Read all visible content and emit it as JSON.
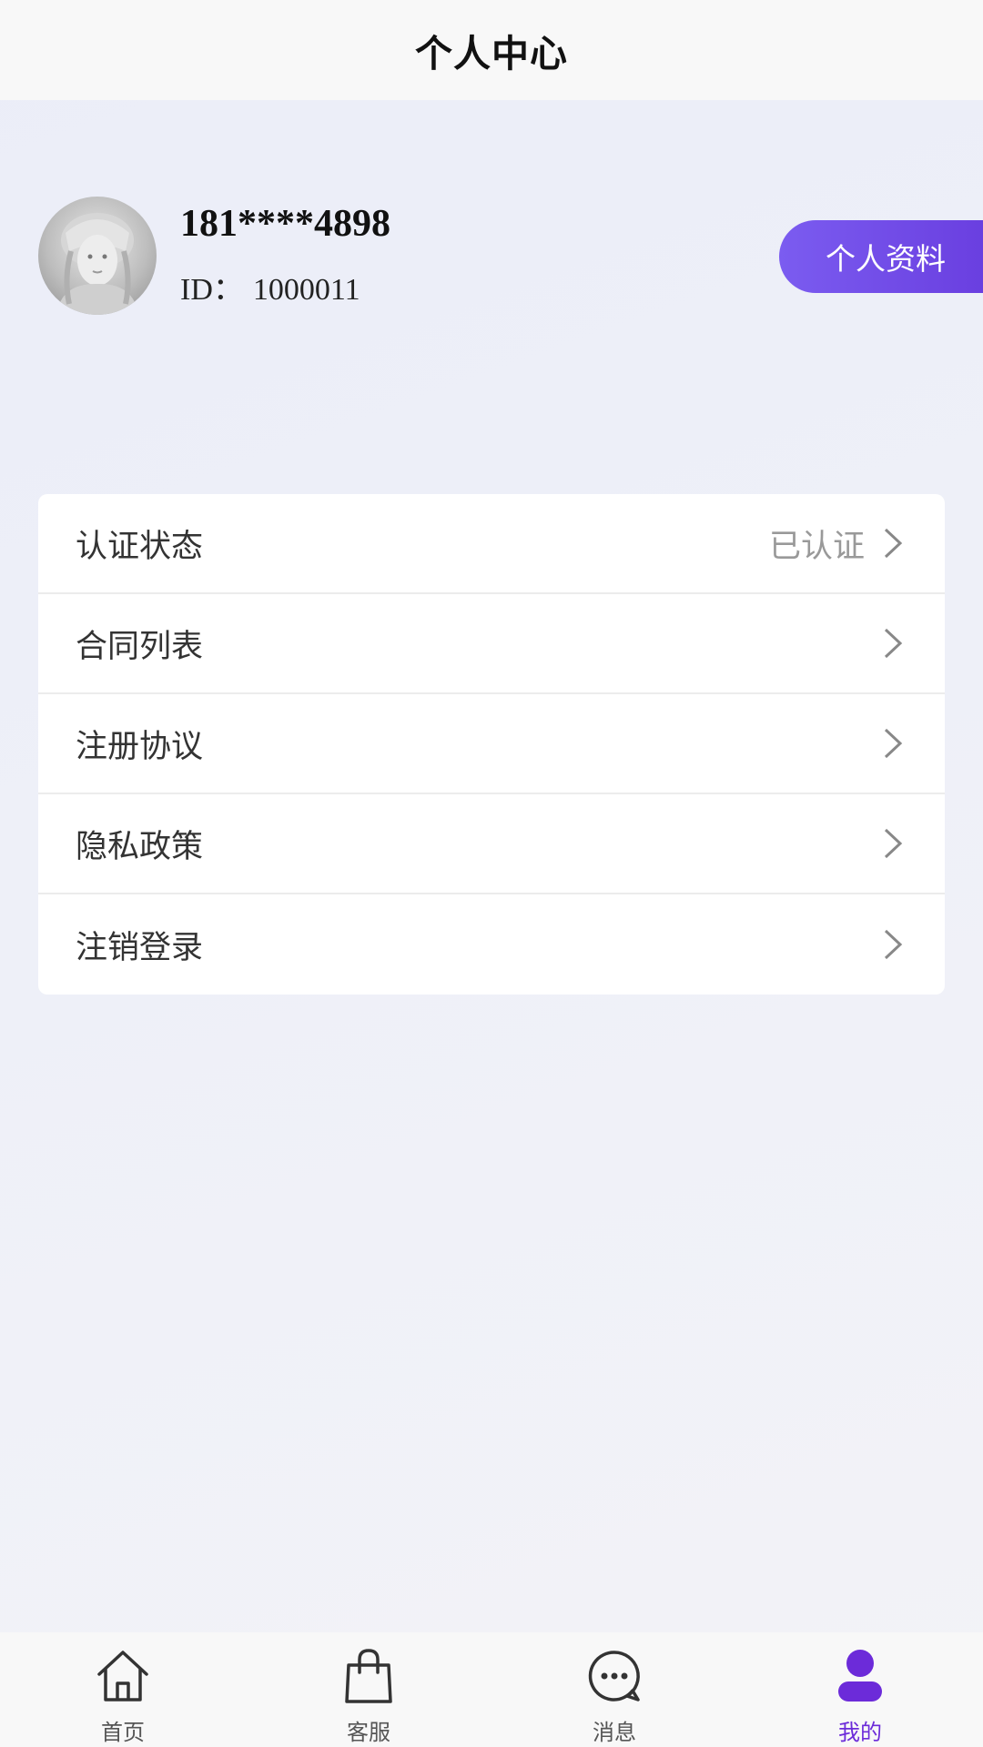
{
  "header": {
    "title": "个人中心"
  },
  "profile": {
    "phone": "181****4898",
    "id_label": "ID：",
    "id_value": "1000011",
    "profile_button": "个人资料"
  },
  "menu": {
    "items": [
      {
        "label": "认证状态",
        "value": "已认证"
      },
      {
        "label": "合同列表",
        "value": ""
      },
      {
        "label": "注册协议",
        "value": ""
      },
      {
        "label": "隐私政策",
        "value": ""
      },
      {
        "label": "注销登录",
        "value": ""
      }
    ]
  },
  "tabbar": {
    "items": [
      {
        "label": "首页",
        "icon": "home-icon",
        "active": false
      },
      {
        "label": "客服",
        "icon": "shopping-bag-icon",
        "active": false
      },
      {
        "label": "消息",
        "icon": "chat-bubble-icon",
        "active": false
      },
      {
        "label": "我的",
        "icon": "user-icon",
        "active": true
      }
    ]
  },
  "colors": {
    "accent": "#6c2bd9",
    "button_gradient_start": "#7b5cf0",
    "button_gradient_end": "#6a3fe0"
  }
}
